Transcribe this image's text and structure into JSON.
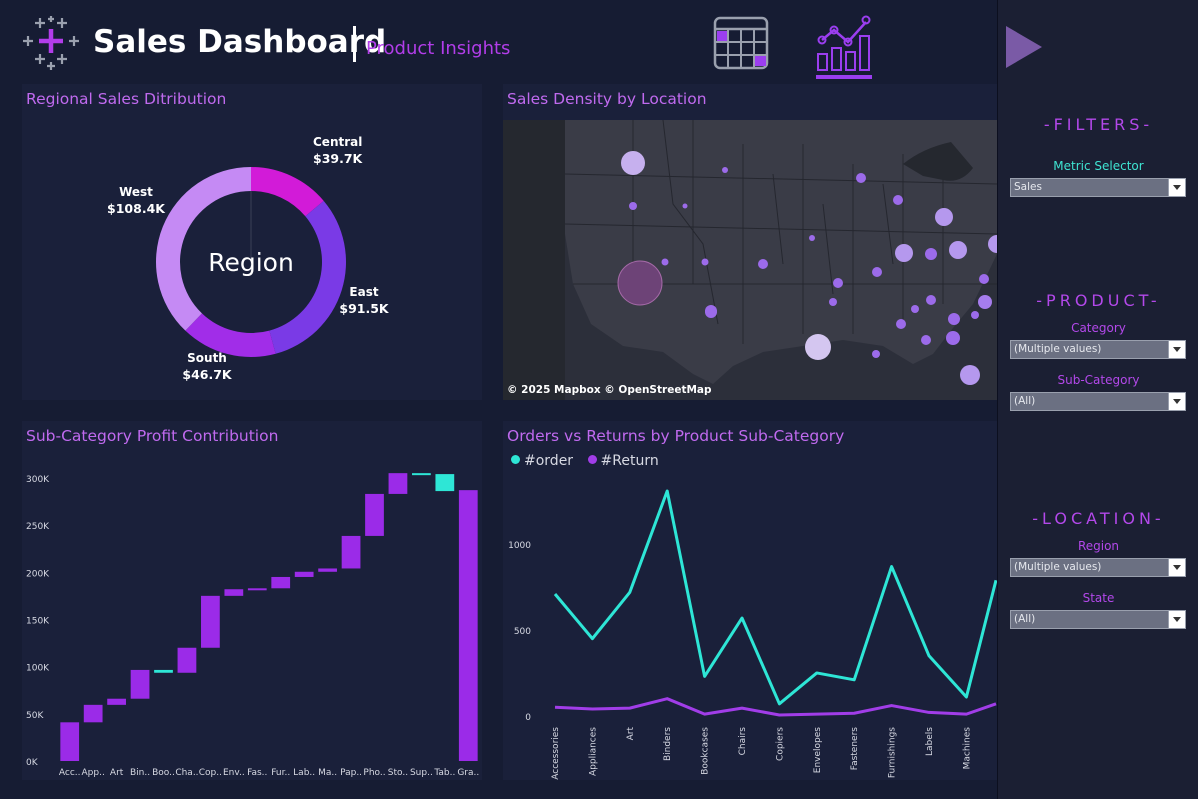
{
  "header": {
    "title": "Sales Dashboard",
    "subtitle": "Product Insights",
    "nav": [
      {
        "name": "table-view",
        "icon": "calendar-grid-icon"
      },
      {
        "name": "chart-view",
        "icon": "bar-line-chart-icon",
        "active": true
      }
    ]
  },
  "colors": {
    "accent": "#9b3ef0",
    "title_purple": "#c06aef",
    "teal": "#2ee6d6",
    "panel": "#1a203a",
    "background": "#161c33"
  },
  "sidebar": {
    "filters_heading": "-FILTERS-",
    "metric_label": "Metric Selector",
    "metric_value": "Sales",
    "product_heading": "-PRODUCT-",
    "category_label": "Category",
    "category_value": "(Multiple values)",
    "subcategory_label": "Sub-Category",
    "subcategory_value": "(All)",
    "location_heading": "-LOCATION-",
    "region_label": "Region",
    "region_value": "(Multiple values)",
    "state_label": "State",
    "state_value": "(All)"
  },
  "map": {
    "title": "Sales Density by Location",
    "attribution": "© 2025 Mapbox © OpenStreetMap"
  },
  "chart_data": [
    {
      "type": "pie",
      "title": "Regional Sales Ditribution",
      "center_label": "Region",
      "slices": [
        {
          "name": "Central",
          "value": 39.7,
          "label": "$39.7K",
          "color": "#d21bd8"
        },
        {
          "name": "East",
          "value": 91.5,
          "label": "$91.5K",
          "color": "#7a3ae6"
        },
        {
          "name": "South",
          "value": 46.7,
          "label": "$46.7K",
          "color": "#a12de8"
        },
        {
          "name": "West",
          "value": 108.4,
          "label": "$108.4K",
          "color": "#c58af4"
        }
      ]
    },
    {
      "type": "bar",
      "subtype": "waterfall",
      "title": "Sub-Category Profit Contribution",
      "categories": [
        "Acc..",
        "App..",
        "Art",
        "Bin..",
        "Boo..",
        "Cha..",
        "Cop..",
        "Env..",
        "Fas..",
        "Fur..",
        "Lab..",
        "Ma..",
        "Pap..",
        "Pho..",
        "Sto..",
        "Sup..",
        "Tab..",
        "Gra.."
      ],
      "deltas": [
        41000,
        18500,
        6500,
        30500,
        -3000,
        26500,
        55000,
        7000,
        1000,
        12000,
        5500,
        3500,
        34500,
        44500,
        22000,
        -1000,
        -18000,
        0
      ],
      "grand_total": 287000,
      "ylim": [
        0,
        320000
      ],
      "yticks": [
        0,
        50000,
        100000,
        150000,
        200000,
        250000,
        300000
      ],
      "ytick_labels": [
        "0K",
        "50K",
        "100K",
        "150K",
        "200K",
        "250K",
        "300K"
      ],
      "positive_color": "#9b2be8",
      "negative_color": "#2ee6d6"
    },
    {
      "type": "line",
      "title": "Orders vs Returns by Product Sub-Category",
      "categories": [
        "Accessories",
        "Appliances",
        "Art",
        "Binders",
        "Bookcases",
        "Chairs",
        "Copiers",
        "Envelopes",
        "Fasteners",
        "Furnishings",
        "Labels",
        "Machines"
      ],
      "series": [
        {
          "name": "#order",
          "color": "#2ee6d6",
          "values": [
            710,
            450,
            720,
            1310,
            230,
            570,
            70,
            250,
            210,
            870,
            350,
            110,
            790
          ]
        },
        {
          "name": "#Return",
          "color": "#a13de8",
          "values": [
            50,
            40,
            45,
            100,
            10,
            45,
            5,
            10,
            15,
            60,
            20,
            10,
            70
          ]
        }
      ],
      "ylim": [
        -30,
        1450
      ],
      "yticks": [
        0,
        500,
        1000
      ],
      "ytick_labels": [
        "0",
        "500",
        "1000"
      ]
    }
  ]
}
